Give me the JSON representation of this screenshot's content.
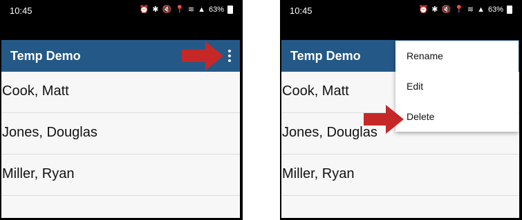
{
  "status_bar": {
    "time": "10:45",
    "battery": "63%",
    "icons": [
      "alarm-icon",
      "bluetooth-icon",
      "mute-icon",
      "location-icon",
      "wifi-icon",
      "signal-icon",
      "battery-icon"
    ]
  },
  "app": {
    "title": "Temp Demo",
    "accent_color": "#245987"
  },
  "list": {
    "items": [
      "Cook, Matt",
      "Jones, Douglas",
      "Miller, Ryan"
    ]
  },
  "overflow_menu": {
    "items": [
      "Rename",
      "Edit",
      "Delete"
    ]
  },
  "annotation": {
    "arrow_color": "#c62828"
  }
}
